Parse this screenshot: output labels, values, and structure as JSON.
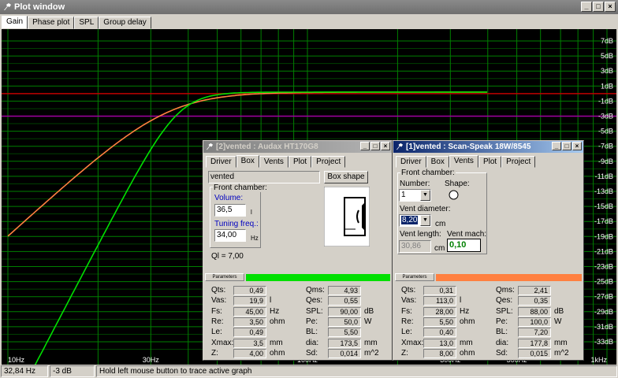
{
  "window": {
    "title": "Plot window"
  },
  "tabs": [
    {
      "label": "Gain"
    },
    {
      "label": "Phase plot"
    },
    {
      "label": "SPL"
    },
    {
      "label": "Group delay"
    }
  ],
  "plot": {
    "y_ticks": [
      "7dB",
      "5dB",
      "3dB",
      "1dB",
      "-1dB",
      "-3dB",
      "-5dB",
      "-7dB",
      "-9dB",
      "-11dB",
      "-13dB",
      "-15dB",
      "-17dB",
      "-19dB",
      "-21dB",
      "-23dB",
      "-25dB",
      "-27dB",
      "-29dB",
      "-31dB",
      "-33dB"
    ],
    "x_ticks": [
      "10Hz",
      "30Hz",
      "100Hz",
      "300Hz",
      "500Hz",
      "1kHz"
    ],
    "colors": {
      "green_curve": "#00e000",
      "orange_curve": "#ff8040",
      "red_line": "#c00000",
      "purple_line": "#a000a0",
      "grid": "#008000"
    }
  },
  "status": {
    "freq": "32,84 Hz",
    "gain": "-3 dB",
    "hint": "Hold left mouse button to trace active graph"
  },
  "win2": {
    "title": "[2]vented : Audax HT170G8",
    "tabs": [
      "Driver",
      "Box",
      "Vents",
      "Plot",
      "Project"
    ],
    "box_type": "vented",
    "box_shape_button": "Box shape",
    "front_chamber_label": "Front chamber:",
    "volume_label": "Volume:",
    "volume_value": "36,5",
    "volume_unit": "l",
    "tuning_label": "Tuning freq.:",
    "tuning_value": "34,00",
    "tuning_unit": "Hz",
    "ql": "Ql = 7,00",
    "params_label": "Parameters",
    "params_color": "#00e000",
    "left_params": [
      {
        "name": "Qts:",
        "value": "0,49",
        "unit": ""
      },
      {
        "name": "Vas:",
        "value": "19,9",
        "unit": "l"
      },
      {
        "name": "Fs:",
        "value": "45,00",
        "unit": "Hz"
      },
      {
        "name": "Re:",
        "value": "3,50",
        "unit": "ohm"
      },
      {
        "name": "Le:",
        "value": "0,49",
        "unit": ""
      },
      {
        "name": "Xmax:",
        "value": "3,5",
        "unit": "mm"
      },
      {
        "name": "Z:",
        "value": "4,00",
        "unit": "ohm"
      }
    ],
    "right_params": [
      {
        "name": "Qms:",
        "value": "4,93",
        "unit": ""
      },
      {
        "name": "Qes:",
        "value": "0,55",
        "unit": ""
      },
      {
        "name": "SPL:",
        "value": "90,00",
        "unit": "dB"
      },
      {
        "name": "Pe:",
        "value": "50,0",
        "unit": "W"
      },
      {
        "name": "BL:",
        "value": "5,50",
        "unit": ""
      },
      {
        "name": "dia:",
        "value": "173,5",
        "unit": "mm"
      },
      {
        "name": "Sd:",
        "value": "0,014",
        "unit": "m^2"
      }
    ]
  },
  "win1": {
    "title": "[1]vented : Scan-Speak 18W/8545",
    "tabs": [
      "Driver",
      "Box",
      "Vents",
      "Plot",
      "Project"
    ],
    "front_chamber_label": "Front chamber:",
    "number_label": "Number:",
    "number_value": "1",
    "shape_label": "Shape:",
    "vent_diameter_label": "Vent diameter:",
    "vent_diameter_value": "8,20",
    "vent_diameter_unit": "cm",
    "vent_length_label": "Vent length:",
    "vent_length_value": "30,86",
    "vent_length_unit": "cm",
    "vent_mach_label": "Vent mach:",
    "vent_mach_value": "0,10",
    "params_label": "Parameters",
    "params_color": "#ff8040",
    "left_params": [
      {
        "name": "Qts:",
        "value": "0,31",
        "unit": ""
      },
      {
        "name": "Vas:",
        "value": "113,0",
        "unit": "l"
      },
      {
        "name": "Fs:",
        "value": "28,00",
        "unit": "Hz"
      },
      {
        "name": "Re:",
        "value": "5,50",
        "unit": "ohm"
      },
      {
        "name": "Le:",
        "value": "0,40",
        "unit": ""
      },
      {
        "name": "Xmax:",
        "value": "13,0",
        "unit": "mm"
      },
      {
        "name": "Z:",
        "value": "8,00",
        "unit": "ohm"
      }
    ],
    "right_params": [
      {
        "name": "Qms:",
        "value": "2,41",
        "unit": ""
      },
      {
        "name": "Qes:",
        "value": "0,35",
        "unit": ""
      },
      {
        "name": "SPL:",
        "value": "88,00",
        "unit": "dB"
      },
      {
        "name": "Pe:",
        "value": "100,0",
        "unit": "W"
      },
      {
        "name": "BL:",
        "value": "7,20",
        "unit": ""
      },
      {
        "name": "dia:",
        "value": "177,8",
        "unit": "mm"
      },
      {
        "name": "Sd:",
        "value": "0,015",
        "unit": "m^2"
      }
    ]
  }
}
